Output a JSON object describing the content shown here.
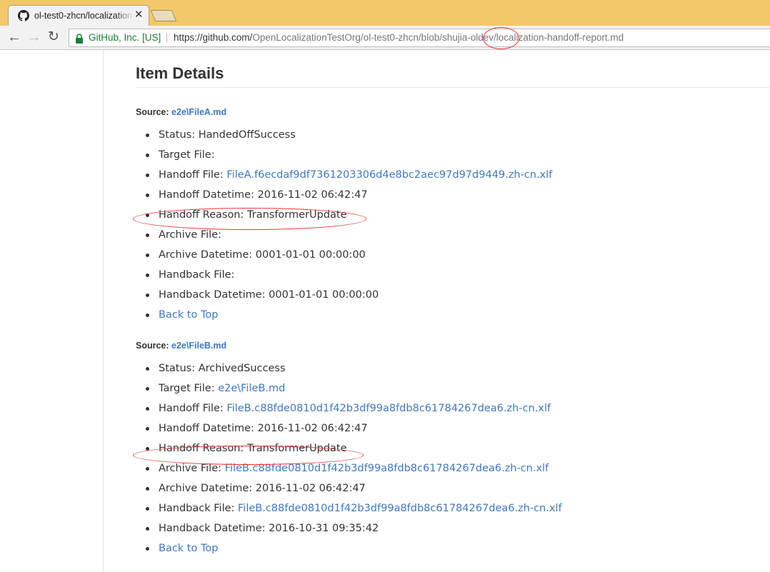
{
  "browser": {
    "tab_title": "ol-test0-zhcn/localization",
    "close_glyph": "✕",
    "site_identity": "GitHub, Inc. [US]",
    "url_prefix": "https://github.com/",
    "url_rest": "OpenLocalizationTestOrg/ol-test0-zhcn/blob/shujia-oldev/localization-handoff-report.md",
    "icons": {
      "back": "←",
      "forward": "→",
      "reload": "↻"
    }
  },
  "page": {
    "heading": "Item Details",
    "sources": [
      {
        "label": "Source:",
        "link": "e2e\\FileA.md",
        "items": [
          {
            "label": "Status:",
            "value": "HandedOffSuccess"
          },
          {
            "label": "Target File:",
            "value": ""
          },
          {
            "label": "Handoff File:",
            "link": "FileA.f6ecdaf9df7361203306d4e8bc2aec97d97d9449.zh-cn.xlf"
          },
          {
            "label": "Handoff Datetime:",
            "value": "2016-11-02 06:42:47"
          },
          {
            "label": "Handoff Reason:",
            "value": "TransformerUpdate"
          },
          {
            "label": "Archive File:",
            "value": ""
          },
          {
            "label": "Archive Datetime:",
            "value": "0001-01-01 00:00:00"
          },
          {
            "label": "Handback File:",
            "value": ""
          },
          {
            "label": "Handback Datetime:",
            "value": "0001-01-01 00:00:00"
          }
        ],
        "back_to_top": "Back to Top"
      },
      {
        "label": "Source:",
        "link": "e2e\\FileB.md",
        "items": [
          {
            "label": "Status:",
            "value": "ArchivedSuccess"
          },
          {
            "label": "Target File:",
            "link": "e2e\\FileB.md"
          },
          {
            "label": "Handoff File:",
            "link": "FileB.c88fde0810d1f42b3df99a8fdb8c61784267dea6.zh-cn.xlf"
          },
          {
            "label": "Handoff Datetime:",
            "value": "2016-11-02 06:42:47"
          },
          {
            "label": "Handoff Reason:",
            "value": "TransformerUpdate"
          },
          {
            "label": "Archive File:",
            "link": "FileB.c88fde0810d1f42b3df99a8fdb8c61784267dea6.zh-cn.xlf"
          },
          {
            "label": "Archive Datetime:",
            "value": "2016-11-02 06:42:47"
          },
          {
            "label": "Handback File:",
            "link": "FileB.c88fde0810d1f42b3df99a8fdb8c61784267dea6.zh-cn.xlf"
          },
          {
            "label": "Handback Datetime:",
            "value": "2016-10-31 09:35:42"
          }
        ],
        "back_to_top": "Back to Top"
      }
    ]
  },
  "colors": {
    "link": "#4078c0",
    "annotation": "#e33333",
    "titlebar": "#f2c86b",
    "secure": "#188038"
  }
}
